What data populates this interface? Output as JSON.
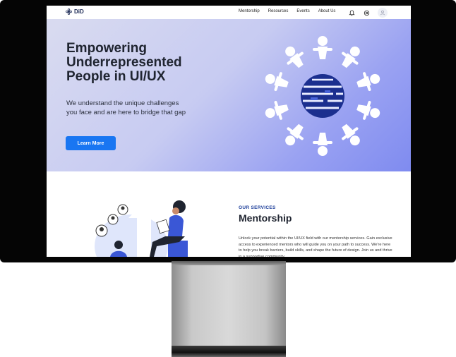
{
  "brand": {
    "name": "DiD"
  },
  "nav": {
    "links": [
      "Mentorship",
      "Resources",
      "Events",
      "About Us"
    ],
    "icons": [
      "bell-icon",
      "settings-icon",
      "user-icon"
    ]
  },
  "hero": {
    "title": "Empowering\nUnderrepresented\nPeople in UI/UX",
    "subtitle": "We understand the unique challenges\nyou face and are here to bridge that gap",
    "cta": "Learn More"
  },
  "services": {
    "eyebrow": "OUR SERVICES",
    "title": "Mentorship",
    "description": "Unlock your potential within the UI/UX field with our mentorship services. Gain exclusive access to experienced mentors who will guide you on your path to success. We're here to help you break barriers, build skills, and shape the future of design. Join us and thrive in a supportive community"
  },
  "colors": {
    "accent": "#1976f2",
    "brand": "#1c2a55",
    "eyebrow": "#1d3f9a",
    "globe": "#1b2f8f"
  }
}
